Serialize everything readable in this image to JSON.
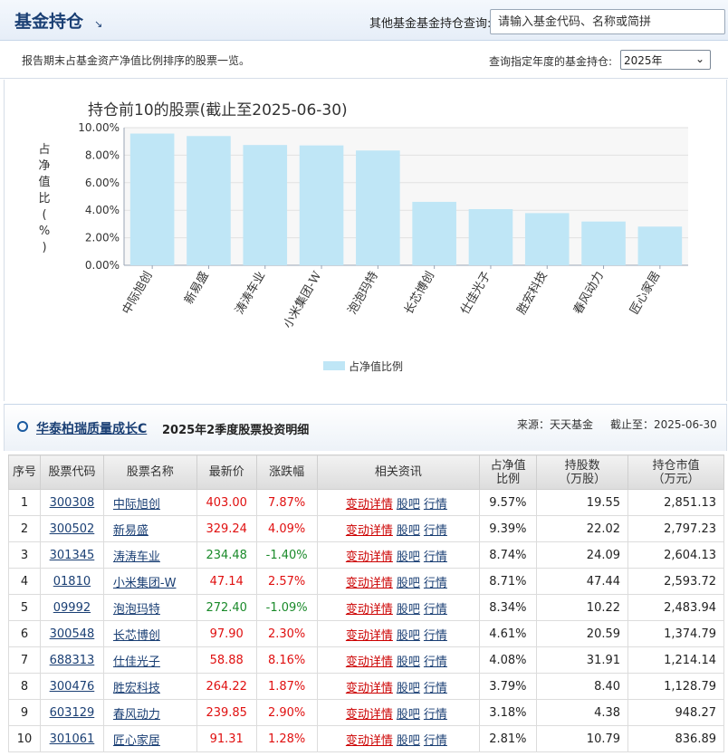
{
  "header": {
    "title": "基金持仓",
    "query_label": "其他基金基金持仓查询:",
    "query_placeholder": "请输入基金代码、名称或简拼"
  },
  "sub": {
    "description": "报告期末占基金资产净值比例排序的股票一览。",
    "year_label": "查询指定年度的基金持仓:",
    "year_value": "2025年"
  },
  "chart_data": {
    "type": "bar",
    "title": "持仓前10的股票(截止至2025-06-30)",
    "ylabel": "占净值比(%)",
    "ylabel_chars": [
      "占",
      "净",
      "值",
      "比",
      "(",
      "%",
      ")"
    ],
    "categories": [
      "中际旭创",
      "新易盛",
      "涛涛车业",
      "小米集团-W",
      "泡泡玛特",
      "长芯博创",
      "仕佳光子",
      "胜宏科技",
      "春风动力",
      "匠心家居"
    ],
    "values": [
      9.57,
      9.39,
      8.74,
      8.71,
      8.34,
      4.61,
      4.08,
      3.79,
      3.18,
      2.81
    ],
    "ylim": [
      0,
      10
    ],
    "yticks": [
      "0.00%",
      "2.00%",
      "4.00%",
      "6.00%",
      "8.00%",
      "10.00%"
    ],
    "legend": "占净值比例",
    "bar_color": "#bfe6f6"
  },
  "detail": {
    "fund_name": "华泰柏瑞质量成长C",
    "quarter_title": "2025年2季度股票投资明细",
    "source": "来源：天天基金",
    "asof": "截止至：2025-06-30"
  },
  "table": {
    "headers": {
      "seq": "序号",
      "code": "股票代码",
      "name": "股票名称",
      "price": "最新价",
      "change": "涨跌幅",
      "news": "相关资讯",
      "ratio1": "占净值",
      "ratio2": "比例",
      "shares1": "持股数",
      "shares2": "（万股）",
      "value1": "持仓市值",
      "value2": "（万元）"
    },
    "news_links": [
      "变动详情",
      "股吧",
      "行情"
    ],
    "rows": [
      {
        "seq": "1",
        "code": "300308",
        "name": "中际旭创",
        "price": "403.00",
        "change": "7.87%",
        "dir": "up",
        "ratio": "9.57%",
        "shares": "19.55",
        "value": "2,851.13"
      },
      {
        "seq": "2",
        "code": "300502",
        "name": "新易盛",
        "price": "329.24",
        "change": "4.09%",
        "dir": "up",
        "ratio": "9.39%",
        "shares": "22.02",
        "value": "2,797.23"
      },
      {
        "seq": "3",
        "code": "301345",
        "name": "涛涛车业",
        "price": "234.48",
        "change": "-1.40%",
        "dir": "down",
        "ratio": "8.74%",
        "shares": "24.09",
        "value": "2,604.13"
      },
      {
        "seq": "4",
        "code": "01810",
        "name": "小米集团-W",
        "price": "47.14",
        "change": "2.57%",
        "dir": "up",
        "ratio": "8.71%",
        "shares": "47.44",
        "value": "2,593.72"
      },
      {
        "seq": "5",
        "code": "09992",
        "name": "泡泡玛特",
        "price": "272.40",
        "change": "-1.09%",
        "dir": "down",
        "ratio": "8.34%",
        "shares": "10.22",
        "value": "2,483.94"
      },
      {
        "seq": "6",
        "code": "300548",
        "name": "长芯博创",
        "price": "97.90",
        "change": "2.30%",
        "dir": "up",
        "ratio": "4.61%",
        "shares": "20.59",
        "value": "1,374.79"
      },
      {
        "seq": "7",
        "code": "688313",
        "name": "仕佳光子",
        "price": "58.88",
        "change": "8.16%",
        "dir": "up",
        "ratio": "4.08%",
        "shares": "31.91",
        "value": "1,214.14"
      },
      {
        "seq": "8",
        "code": "300476",
        "name": "胜宏科技",
        "price": "264.22",
        "change": "1.87%",
        "dir": "up",
        "ratio": "3.79%",
        "shares": "8.40",
        "value": "1,128.79"
      },
      {
        "seq": "9",
        "code": "603129",
        "name": "春风动力",
        "price": "239.85",
        "change": "2.90%",
        "dir": "up",
        "ratio": "3.18%",
        "shares": "4.38",
        "value": "948.27"
      },
      {
        "seq": "10",
        "code": "301061",
        "name": "匠心家居",
        "price": "91.31",
        "change": "1.28%",
        "dir": "up",
        "ratio": "2.81%",
        "shares": "10.79",
        "value": "836.89"
      }
    ]
  }
}
